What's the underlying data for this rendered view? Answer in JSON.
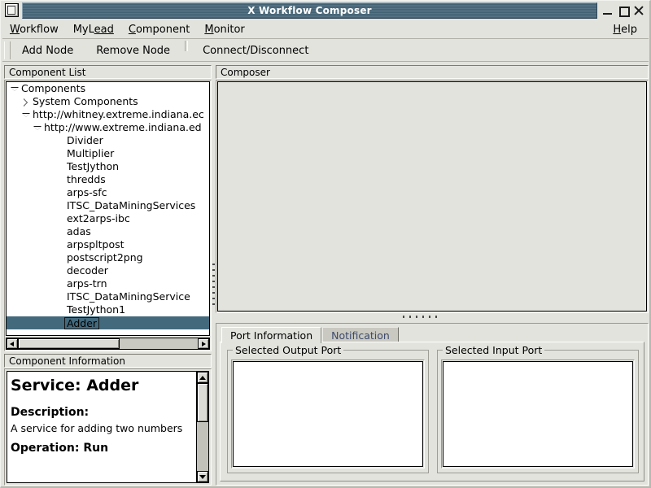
{
  "window": {
    "title": "X Workflow Composer",
    "buttons": {
      "minimize": "minimize",
      "maximize": "maximize",
      "close": "close"
    }
  },
  "menubar": {
    "items": [
      {
        "label": "Workflow",
        "pre": "W",
        "post": "orkflow"
      },
      {
        "label": "MyLead",
        "pre": "MyL",
        "post": "ead"
      },
      {
        "label": "Component",
        "pre": "C",
        "post": "omponent"
      },
      {
        "label": "Monitor",
        "pre": "M",
        "post": "onitor"
      }
    ],
    "help": {
      "label": "Help",
      "pre": "H",
      "post": "elp"
    }
  },
  "toolbar": {
    "add_node": "Add Node",
    "remove_node": "Remove Node",
    "connect_disconnect": "Connect/Disconnect"
  },
  "component_list": {
    "title": "Component List",
    "nodes": [
      {
        "label": "Components",
        "indent": 0,
        "toggle": "down"
      },
      {
        "label": "System Components",
        "indent": 1,
        "toggle": "right"
      },
      {
        "label": "http://whitney.extreme.indiana.ec",
        "indent": 1,
        "toggle": "down"
      },
      {
        "label": "http://www.extreme.indiana.ed",
        "indent": 2,
        "toggle": "down"
      },
      {
        "label": "Divider",
        "indent": 4,
        "toggle": "none"
      },
      {
        "label": "Multiplier",
        "indent": 4,
        "toggle": "none"
      },
      {
        "label": "TestJython",
        "indent": 4,
        "toggle": "none"
      },
      {
        "label": "thredds",
        "indent": 4,
        "toggle": "none"
      },
      {
        "label": "arps-sfc",
        "indent": 4,
        "toggle": "none"
      },
      {
        "label": "ITSC_DataMiningServices",
        "indent": 4,
        "toggle": "none"
      },
      {
        "label": "ext2arps-ibc",
        "indent": 4,
        "toggle": "none"
      },
      {
        "label": "adas",
        "indent": 4,
        "toggle": "none"
      },
      {
        "label": "arpspltpost",
        "indent": 4,
        "toggle": "none"
      },
      {
        "label": "postscript2png",
        "indent": 4,
        "toggle": "none"
      },
      {
        "label": "decoder",
        "indent": 4,
        "toggle": "none"
      },
      {
        "label": "arps-trn",
        "indent": 4,
        "toggle": "none"
      },
      {
        "label": "ITSC_DataMiningService",
        "indent": 4,
        "toggle": "none"
      },
      {
        "label": "TestJython1",
        "indent": 4,
        "toggle": "none"
      },
      {
        "label": "Adder",
        "indent": 4,
        "toggle": "none",
        "selected": true
      }
    ],
    "selection_color": "#43697d"
  },
  "component_information": {
    "title": "Component Information",
    "service_heading": "Service: Adder",
    "description_heading": "Description:",
    "description_text": "A service for adding two numbers",
    "operation_heading": "Operation: Run"
  },
  "composer": {
    "title": "Composer"
  },
  "port_information": {
    "tabs": [
      {
        "label": "Port Information",
        "active": true
      },
      {
        "label": "Notification",
        "active": false
      }
    ],
    "output_group": {
      "title": "Selected Output Port",
      "value": ""
    },
    "input_group": {
      "title": "Selected Input Port",
      "value": ""
    }
  }
}
